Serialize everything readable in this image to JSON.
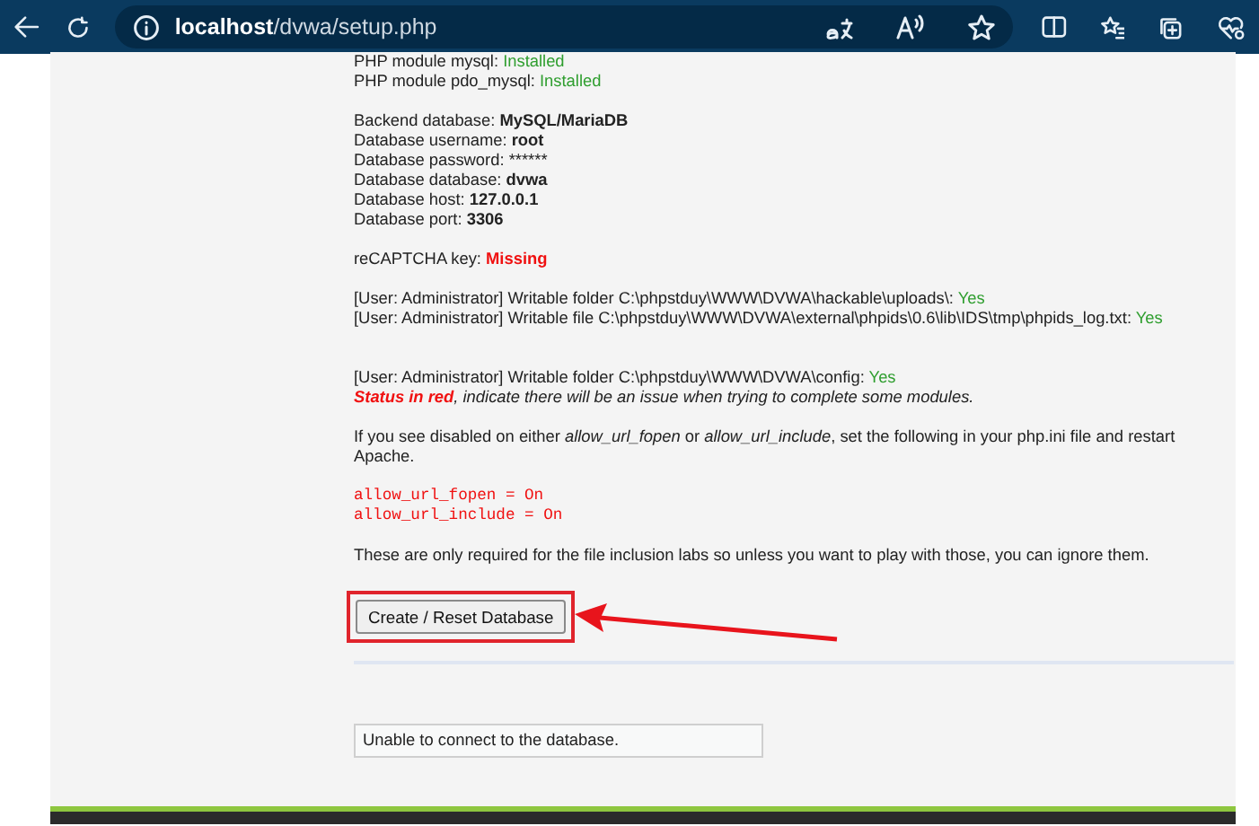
{
  "browser": {
    "url_host": "localhost",
    "url_path": "/dvwa/setup.php"
  },
  "sections": [
    [
      {
        "label": "PHP module mysql: ",
        "value": "Installed",
        "kind": "ok"
      },
      {
        "label": "PHP module pdo_mysql: ",
        "value": "Installed",
        "kind": "ok"
      }
    ],
    [
      {
        "label": "Backend database: ",
        "value": "MySQL/MariaDB",
        "kind": "setting"
      },
      {
        "label": "Database username: ",
        "value": "root",
        "kind": "setting"
      },
      {
        "label": "Database password: ",
        "value": "******",
        "kind": "secret"
      },
      {
        "label": "Database database: ",
        "value": "dvwa",
        "kind": "setting"
      },
      {
        "label": "Database host: ",
        "value": "127.0.0.1",
        "kind": "setting"
      },
      {
        "label": "Database port: ",
        "value": "3306",
        "kind": "setting"
      }
    ],
    [
      {
        "label": "reCAPTCHA key: ",
        "value": "Missing",
        "kind": "error"
      }
    ],
    [
      {
        "label": "[User: Administrator] Writable folder C:\\phpstduy\\WWW\\DVWA\\hackable\\uploads\\: ",
        "value": "Yes",
        "kind": "ok"
      },
      {
        "label": "[User: Administrator] Writable file C:\\phpstduy\\WWW\\DVWA\\external\\phpids\\0.6\\lib\\IDS\\tmp\\phpids_log.txt: ",
        "value": "Yes",
        "kind": "ok"
      }
    ]
  ],
  "config_line": {
    "label": "[User: Administrator] Writable folder C:\\phpstduy\\WWW\\DVWA\\config: ",
    "value": "Yes",
    "kind": "ok"
  },
  "note": {
    "emphasis": "Status in red",
    "text": ", indicate there will be an issue when trying to complete some modules."
  },
  "instructions": "If you see disabled on either *allow_url_fopen* or *allow_url_include*, set the following in your php.ini file and restart Apache.",
  "code_lines": [
    "allow_url_fopen = On",
    "allow_url_include = On"
  ],
  "footnote": "These are only required for the file inclusion labs so unless you want to play with those, you can ignore them.",
  "button": {
    "label": "Create / Reset Database",
    "highlighted": true
  },
  "message": "Unable to connect to the database."
}
